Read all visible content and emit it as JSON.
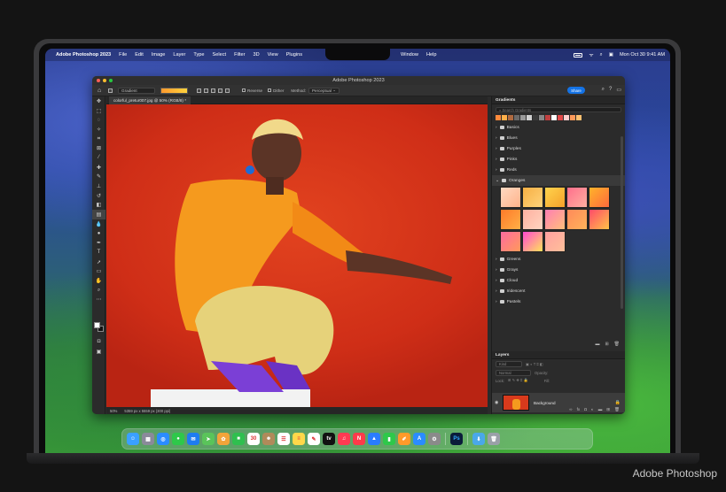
{
  "menubar": {
    "app_name": "Adobe Photoshop 2023",
    "menus": [
      "File",
      "Edit",
      "Image",
      "Layer",
      "Type",
      "Select",
      "Filter",
      "3D",
      "View",
      "Plugins"
    ],
    "right_menus": [
      "Window",
      "Help"
    ],
    "clock": "Mon Oct 30  9:41 AM"
  },
  "window": {
    "title": "Adobe Photoshop 2023",
    "options": {
      "tool_preset": "Gradient",
      "reverse_label": "Reverse",
      "dither_label": "Dither",
      "method_label": "Method:",
      "method_value": "Perceptual",
      "share_label": "Share"
    },
    "document_tab": "colorful_pretur007.jpg @ 50% (RGB/8) *",
    "status": {
      "zoom": "50%",
      "info": "5359 px x 5559 px (300 ppi)"
    }
  },
  "gradients_panel": {
    "title": "Gradients",
    "search_placeholder": "Search Gradients",
    "folders_top": [
      "Basics",
      "Blues",
      "Purples",
      "Pinks",
      "Reds"
    ],
    "open_folder": "Oranges",
    "folders_bottom": [
      "Greens",
      "Grays",
      "Cloud",
      "Iridescent",
      "Pastels"
    ],
    "swatches": [
      [
        "#ffd9c2",
        "#ffb38a"
      ],
      [
        "#f6b044",
        "#ffd27a"
      ],
      [
        "#ffd34d",
        "#f5a12a"
      ],
      [
        "#ff6f8c",
        "#ffb0a0"
      ],
      [
        "#ffb32a",
        "#ff6a3c"
      ],
      [
        "#ff7a2a",
        "#ffb046"
      ],
      [
        "#ffb0a0",
        "#ffd5c0"
      ],
      [
        "#ff7eb3",
        "#ffc07a"
      ],
      [
        "#ff8a5a",
        "#ffb35a"
      ],
      [
        "#ff4a6a",
        "#ffc247"
      ],
      [
        "#ff6aa0",
        "#ff9a5a"
      ],
      [
        "#ff4ad0",
        "#ffe25a"
      ],
      [
        "#ffa0a0",
        "#ffc09a"
      ]
    ],
    "preset_colors": [
      "#ff8a3c",
      "#ffb04a",
      "#b06a40",
      "#6a6a6a",
      "#9a9a9a",
      "#d0d0d0",
      "#3a3a3a",
      "#888888",
      "#c04040",
      "#ffffff",
      "#e24848",
      "#ffd0d0",
      "#ff9a5a",
      "#ffc070"
    ]
  },
  "layers_panel": {
    "title": "Layers",
    "kind_label": "Kind",
    "blend_mode": "Normal",
    "opacity_label": "Opacity:",
    "lock_label": "Lock:",
    "fill_label": "Fill:",
    "layer_name": "Background"
  },
  "dock": {
    "apps": [
      {
        "name": "finder",
        "color": "#3aa0ff",
        "glyph": "☺"
      },
      {
        "name": "launchpad",
        "color": "#8a8a9a",
        "glyph": "▦"
      },
      {
        "name": "safari",
        "color": "#2a8cff",
        "glyph": "◎"
      },
      {
        "name": "messages",
        "color": "#2ec84a",
        "glyph": "●"
      },
      {
        "name": "mail",
        "color": "#1e7cf0",
        "glyph": "✉"
      },
      {
        "name": "maps",
        "color": "#5ac45a",
        "glyph": "➤"
      },
      {
        "name": "photos",
        "color": "#f2a43a",
        "glyph": "✿"
      },
      {
        "name": "facetime",
        "color": "#2fbf4f",
        "glyph": "■"
      },
      {
        "name": "calendar",
        "color": "#ffffff",
        "glyph": "30"
      },
      {
        "name": "contacts",
        "color": "#b08a5a",
        "glyph": "☻"
      },
      {
        "name": "reminders",
        "color": "#ffffff",
        "glyph": "☰"
      },
      {
        "name": "notes",
        "color": "#ffd84a",
        "glyph": "≡"
      },
      {
        "name": "freeform",
        "color": "#ffffff",
        "glyph": "✎"
      },
      {
        "name": "tv",
        "color": "#111111",
        "glyph": "tv"
      },
      {
        "name": "music",
        "color": "#ff3a52",
        "glyph": "♫"
      },
      {
        "name": "news",
        "color": "#ff3a4a",
        "glyph": "N"
      },
      {
        "name": "keynote",
        "color": "#2a7cff",
        "glyph": "▲"
      },
      {
        "name": "numbers",
        "color": "#2ec84a",
        "glyph": "▮"
      },
      {
        "name": "pages",
        "color": "#ff9a2a",
        "glyph": "✐"
      },
      {
        "name": "app-store",
        "color": "#2a8cff",
        "glyph": "A"
      },
      {
        "name": "system-settings",
        "color": "#8a8a8a",
        "glyph": "⚙"
      },
      {
        "name": "photoshop",
        "color": "#0b1c3a",
        "glyph": "Ps"
      },
      {
        "name": "downloads",
        "color": "#4aa8e8",
        "glyph": "⬇"
      },
      {
        "name": "trash",
        "color": "#9aa0a8",
        "glyph": "🗑"
      }
    ]
  },
  "caption": "Adobe Photoshop"
}
